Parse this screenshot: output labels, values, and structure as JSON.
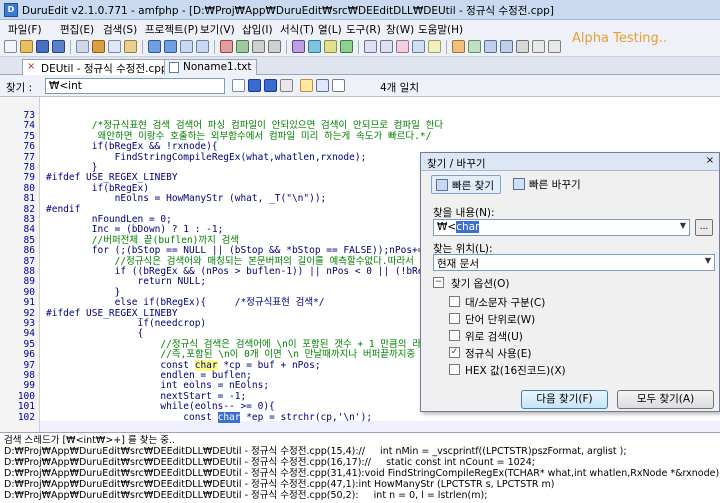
{
  "window": {
    "title": "DuruEdit v2.1.0.771 - amfphp - [D:₩Proj₩App₩DuruEdit₩src₩DEEditDLL₩DEUtil - 정규식 수정전.cpp]"
  },
  "menu": [
    "파일(F)",
    "편집(E)",
    "검색(S)",
    "프로젝트(P)",
    "보기(V)",
    "삽입(I)",
    "서식(T)",
    "열(L)",
    "도구(R)",
    "창(W)",
    "도움말(H)"
  ],
  "banner": "Alpha Testing..",
  "tabs": [
    {
      "label": "DEUtil - 정규식 수정전.cpp",
      "active": true
    },
    {
      "label": "Noname1.txt",
      "active": false
    }
  ],
  "findbar": {
    "label": "찾기 :",
    "value": "₩<int",
    "count": "4개 일치"
  },
  "editor": {
    "lines": [
      {
        "n": "73",
        "t": ""
      },
      {
        "n": "74",
        "t": "        /*정규식표현 검색 검색어 파싱 컴파일이 안되있으면 검색이 안되므로 컴파일 한다",
        "c": "cm"
      },
      {
        "n": "75",
        "t": "         왜안하면 이랑수 호출하는 외부함수에서 컴파일 미리 하는게 속도가 빠르다.*/",
        "c": "cm"
      },
      {
        "n": "76",
        "t": "        if(bRegEx && !rxnode){"
      },
      {
        "n": "77",
        "t": "            FindStringCompileRegEx(what,whatlen,rxnode);"
      },
      {
        "n": "78",
        "t": "        }"
      },
      {
        "n": "79",
        "t": "#ifdef USE_REGEX_LINEBY",
        "c": "pp"
      },
      {
        "n": "80",
        "t": "        if(bRegEx)"
      },
      {
        "n": "81",
        "t": "            nEolns = HowManyStr (what, _T(\"\\n\"));"
      },
      {
        "n": "82",
        "t": "#endif",
        "c": "pp"
      },
      {
        "n": "83",
        "t": "        nFoundLen = 0;"
      },
      {
        "n": "84",
        "t": "        Inc = (bDown) ? 1 : -1;"
      },
      {
        "n": "85",
        "t": "        //버퍼전체 끝(buflen)까지 검색",
        "c": "cm"
      },
      {
        "n": "86",
        "t": "        for (;(bStop == NULL || (bStop && *bStop == FALSE));nPos+=Inc) {"
      },
      {
        "n": "87",
        "t": "            //정규식은 검색어와 매칭되는 본문버퍼의 길이를 예측할수없다.따라서",
        "c": "cm"
      },
      {
        "n": "88",
        "t": "            if ((bRegEx && (nPos > buflen-1)) || nPos < 0 || (!bRegEx && (nPos"
      },
      {
        "n": "89",
        "t": "                return NULL;"
      },
      {
        "n": "90",
        "t": "            }"
      },
      {
        "n": "91",
        "t": "            else if(bRegEx){     /*정규식표현 검색*/"
      },
      {
        "n": "92",
        "t": "#ifdef USE_REGEX_LINEBY",
        "c": "pp"
      },
      {
        "n": "93",
        "t": "                if(needcrop)"
      },
      {
        "n": "94",
        "t": "                {"
      },
      {
        "n": "95",
        "t": "                    //정규식 검색은 검색어에 \\n이 포함된 갯수 + 1 만큼의 라",
        "c": "cm"
      },
      {
        "n": "96",
        "t": "                    //즉,포함된 \\n이 0개 이면 \\n 만날때까지나 버퍼끝까지중",
        "c": "cm"
      },
      {
        "n": "97",
        "t": "                    const char *cp = buf + nPos;"
      },
      {
        "n": "98",
        "t": "                    endlen = buflen;"
      },
      {
        "n": "99",
        "t": "                    int eolns = nEolns;"
      },
      {
        "n": "100",
        "t": "                    nextStart = -1;"
      },
      {
        "n": "101",
        "t": "                    while(eolns-- >= 0){"
      },
      {
        "n": "102",
        "t": "                        const char *ep = strchr(cp,'\\n');"
      }
    ]
  },
  "output": {
    "lines": [
      "검색 스레드가 [₩<int₩>+] 를 찾는 중..",
      "D:₩Proj₩App₩DuruEdit₩src₩DEEditDLL₩DEUtil - 정규식 수정전.cpp(15,4)://     int nMin = _vscprintf((LPCTSTR)pszFormat, arglist );",
      "D:₩Proj₩App₩DuruEdit₩src₩DEEditDLL₩DEUtil - 정규식 수정전.cpp(16,17)://     static const int nCount = 1024;",
      "D:₩Proj₩App₩DuruEdit₩src₩DEEditDLL₩DEUtil - 정규식 수정전.cpp(31,41):void FindStringCompileRegEx(TCHAR* what,int whatlen,RxNode *&rxnode)",
      "D:₩Proj₩App₩DuruEdit₩src₩DEEditDLL₩DEUtil - 정규식 수정전.cpp(47,1):int HowManyStr (LPCTSTR s, LPCTSTR m)",
      "D:₩Proj₩App₩DuruEdit₩src₩DEEditDLL₩DEUtil - 정규식 수정전.cpp(50,2):     int n = 0, l = lstrlen(m);"
    ]
  },
  "dialog": {
    "title": "찾기 / 바꾸기",
    "tab_find": "빠른 찾기",
    "tab_replace": "빠른 바꾸기",
    "find_label": "찾을 내용(N):",
    "find_value": "₩<char",
    "location_label": "찾는 위치(L):",
    "location_value": "현재 문서",
    "options_label": "찾기 옵션(O)",
    "options": [
      {
        "label": "대/소문자 구분(C)",
        "checked": false
      },
      {
        "label": "단어 단위로(W)",
        "checked": false
      },
      {
        "label": "위로 검색(U)",
        "checked": false
      },
      {
        "label": "정규식 사용(E)",
        "checked": true
      },
      {
        "label": "HEX 값(16진코드)(X)",
        "checked": false
      }
    ],
    "find_next": "다음 찾기(F)",
    "find_all": "모두 찾기(A)",
    "browse_btn": "...",
    "close_glyph": "×",
    "check_glyph": "✓",
    "collapse_glyph": "−"
  }
}
